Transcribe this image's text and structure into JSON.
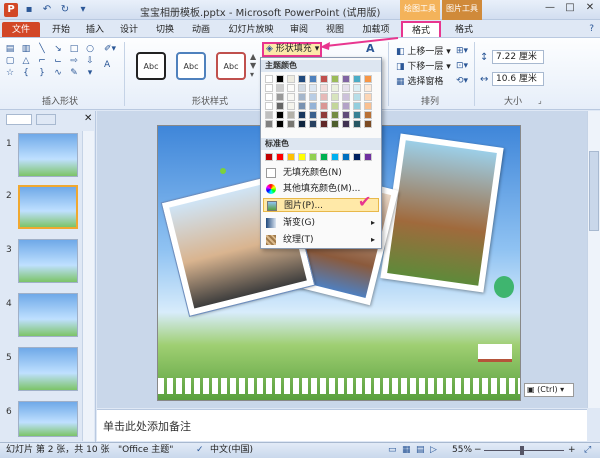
{
  "window": {
    "title": "宝宝相册模板.pptx - Microsoft PowerPoint (试用版)",
    "context_group_draw": "绘图工具",
    "context_group_pic": "图片工具",
    "app_icon": "P"
  },
  "tabs": [
    {
      "label": "文件"
    },
    {
      "label": "开始"
    },
    {
      "label": "插入"
    },
    {
      "label": "设计"
    },
    {
      "label": "切换"
    },
    {
      "label": "动画"
    },
    {
      "label": "幻灯片放映"
    },
    {
      "label": "审阅"
    },
    {
      "label": "视图"
    },
    {
      "label": "加载项"
    },
    {
      "label": "格式"
    },
    {
      "label": "格式"
    }
  ],
  "ribbon": {
    "group_insert_shapes": "插入形状",
    "group_shape_styles": "形状样式",
    "group_arrange": "排列",
    "group_size": "大小",
    "style_sample": "Abc",
    "shape_fill": "形状填充",
    "bring_forward": "上移一层",
    "send_backward": "下移一层",
    "selection_pane": "选择窗格",
    "height_value": "7.22 厘米",
    "width_value": "10.6 厘米"
  },
  "dropdown": {
    "theme_colors": "主题颜色",
    "standard_colors": "标准色",
    "no_fill": "无填充颜色(N)",
    "more_colors": "其他填充颜色(M)...",
    "picture": "图片(P)...",
    "gradient": "渐变(G)",
    "texture": "纹理(T)",
    "theme_row": [
      "#ffffff",
      "#000000",
      "#eeece1",
      "#1f497d",
      "#4f81bd",
      "#c0504d",
      "#9bbb59",
      "#8064a2",
      "#4bacc6",
      "#f79646"
    ],
    "standard_row": [
      "#c00000",
      "#ff0000",
      "#ffc000",
      "#ffff00",
      "#92d050",
      "#00b050",
      "#00b0f0",
      "#0070c0",
      "#002060",
      "#7030a0"
    ]
  },
  "slides": [
    {
      "num": "1"
    },
    {
      "num": "2"
    },
    {
      "num": "3"
    },
    {
      "num": "4"
    },
    {
      "num": "5"
    },
    {
      "num": "6"
    }
  ],
  "notes_placeholder": "单击此处添加备注",
  "ctrl_tag": "(Ctrl)",
  "status": {
    "slide_info": "幻灯片 第 2 张，共 10 张",
    "theme": "\"Office 主题\"",
    "language": "中文(中国)",
    "zoom": "55%"
  }
}
